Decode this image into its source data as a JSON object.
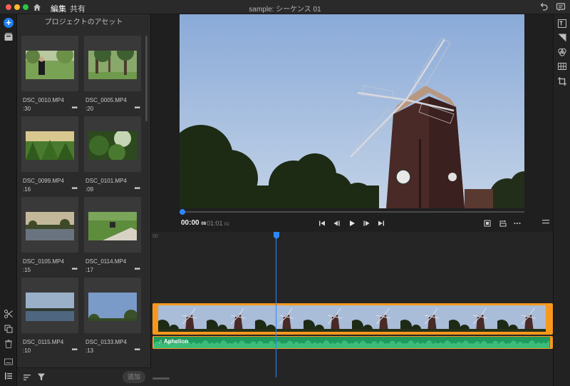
{
  "titlebar": {
    "tabs": [
      {
        "label": "編集",
        "active": true
      },
      {
        "label": "共有",
        "active": false
      }
    ],
    "window_title": "sample: シーケンス 01",
    "icons": [
      "home-icon",
      "undo-icon",
      "comment-icon"
    ]
  },
  "left_toolbar": {
    "add_symbol": "+",
    "icons": [
      "add-icon",
      "media-library-icon",
      "scissors-icon",
      "duplicate-icon",
      "trash-icon",
      "caption-icon",
      "track-list-icon"
    ]
  },
  "assets": {
    "header": "プロジェクトのアセット",
    "more_symbol": "•••",
    "add_button": "追加",
    "items": [
      {
        "name": "DSC_0010.MP4",
        "duration": ":30",
        "scene": "person-park"
      },
      {
        "name": "DSC_0005.MP4",
        "duration": ":20",
        "scene": "trees"
      },
      {
        "name": "DSC_0099.MP4",
        "duration": ":16",
        "scene": "plants"
      },
      {
        "name": "DSC_0101.MP4",
        "duration": ":09",
        "scene": "foliage"
      },
      {
        "name": "DSC_0105.MP4",
        "duration": ":15",
        "scene": "pond"
      },
      {
        "name": "DSC_0114.MP4",
        "duration": ":17",
        "scene": "bench"
      },
      {
        "name": "DSC_0115.MP4",
        "duration": ":10",
        "scene": "lake-sky"
      },
      {
        "name": "DSC_0133.MP4",
        "duration": ":13",
        "scene": "sky-trees"
      }
    ]
  },
  "viewer": {
    "timecode_current": "00:00",
    "timecode_current_frames": "08",
    "timecode_total": "01:01",
    "timecode_total_frames": "01",
    "controls": [
      "skip-back-icon",
      "step-back-icon",
      "play-icon",
      "step-forward-icon",
      "skip-forward-icon",
      "fit-icon",
      "loop-icon",
      "more-icon"
    ],
    "playhead_fraction": 0.002
  },
  "timeline": {
    "ruler_start": "00",
    "audio_clip_label": "♫ Aphelion",
    "frame_count": 8
  },
  "right_toolbar": {
    "icons": [
      "titles-icon",
      "transitions-icon",
      "color-icon",
      "layout-icon",
      "crop-icon"
    ]
  },
  "colors": {
    "accent": "#2d88ff",
    "clip_orange": "#f7981d",
    "audio_green": "#1f9a5d"
  }
}
